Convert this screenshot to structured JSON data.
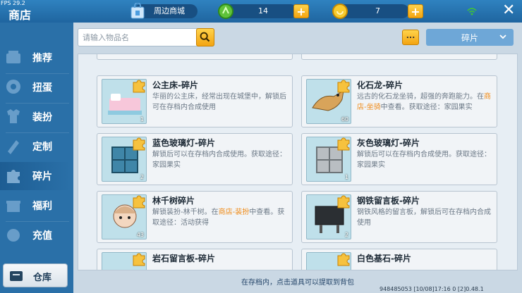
{
  "topbar": {
    "fps": "FPS 29.2",
    "title": "商店",
    "mall_label": "周边商城>>",
    "currency1": "14",
    "currency2": "7",
    "plus": "+"
  },
  "sidebar": {
    "items": [
      {
        "label": "推荐",
        "icon": "recommend-icon"
      },
      {
        "label": "扭蛋",
        "icon": "gacha-icon"
      },
      {
        "label": "装扮",
        "icon": "outfit-icon"
      },
      {
        "label": "定制",
        "icon": "custom-icon"
      },
      {
        "label": "碎片",
        "icon": "fragment-icon"
      },
      {
        "label": "福利",
        "icon": "gift-icon"
      },
      {
        "label": "充值",
        "icon": "recharge-icon"
      }
    ],
    "warehouse": "仓库"
  },
  "search": {
    "placeholder": "请输入物品名"
  },
  "more_label": "...",
  "dropdown": {
    "selected": "碎片"
  },
  "cards": [
    {
      "title": "公主床-碎片",
      "desc_parts": [
        "华丽的公主床，经常出现在城堡中，解锁后可在存档内合成使用"
      ],
      "count": "1"
    },
    {
      "title": "化石龙-碎片",
      "desc_parts": [
        "远古的化石龙坐骑，超强的奔跑能力。在",
        "商店-坐骑",
        "中查看。获取途径：家园果实"
      ],
      "count": "60"
    },
    {
      "title": "蓝色玻璃灯-碎片",
      "desc_parts": [
        "解锁后可以在存档内合成使用。获取途径：家园果实"
      ],
      "count": "2"
    },
    {
      "title": "灰色玻璃灯-碎片",
      "desc_parts": [
        "解锁后可以在存档内合成使用。获取途径：家园果实"
      ],
      "count": "1"
    },
    {
      "title": "林千树碎片",
      "desc_parts": [
        "解锁装扮-林千树。在",
        "商店-装扮",
        "中查看。获取途径：活动获得"
      ],
      "count": "43"
    },
    {
      "title": "钢铁留言板-碎片",
      "desc_parts": [
        "钢铁风格的留言板，解锁后可在存档内合成使用"
      ],
      "count": "2"
    },
    {
      "title": "岩石留言板-碎片",
      "desc_parts": [
        ""
      ],
      "count": ""
    },
    {
      "title": "白色基石-碎片",
      "desc_parts": [
        ""
      ],
      "count": ""
    }
  ],
  "bottom_tip": "在存档内，点击道具可以提取到背包",
  "footer": "948485053    [10/08]17:16 0    [2]0.48.1",
  "colors": {
    "accent": "#f3a412",
    "highlight": "#f08a16",
    "sidebar_bg": "#2a70a8"
  }
}
